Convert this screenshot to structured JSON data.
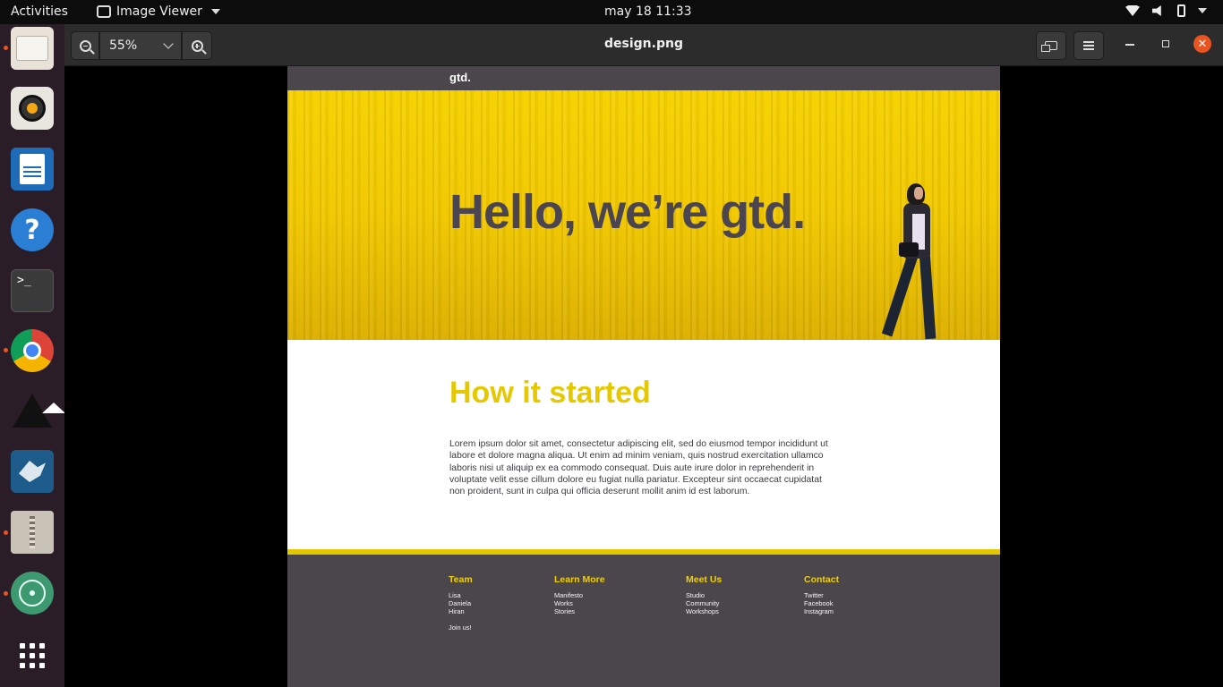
{
  "topbar": {
    "activities": "Activities",
    "app_name": "Image Viewer",
    "clock": "may 18  11:33"
  },
  "dock": {
    "apps": [
      "Files",
      "Rhythmbox",
      "LibreOffice Writer",
      "Help",
      "Terminal",
      "Google Chrome",
      "Inkscape",
      "MySQL Workbench",
      "Archive Manager",
      "Atom",
      "Show Applications"
    ],
    "running_indicators": [
      "Files",
      "Google Chrome",
      "Archive Manager",
      "Atom"
    ]
  },
  "viewer": {
    "zoom": "55%",
    "filename": "design.png",
    "close_glyph": "✕"
  },
  "design": {
    "logo": "gtd.",
    "hero_headline": "Hello, we’re gtd.",
    "section_heading": "How it started",
    "paragraph": "Lorem ipsum dolor sit amet, consectetur adipiscing elit, sed do eiusmod tempor incididunt ut labore et dolore magna aliqua. Ut enim ad minim veniam, quis nostrud exercitation ullamco laboris nisi ut aliquip ex ea commodo consequat. Duis aute irure dolor in reprehenderit in voluptate velit esse cillum dolore eu fugiat nulla pariatur. Excepteur sint occaecat cupidatat non proident, sunt in culpa qui officia deserunt mollit anim id est laborum.",
    "footer": {
      "team": {
        "heading": "Team",
        "items": [
          "Lisa",
          "Daniela",
          "Hiran"
        ],
        "extra": "Join us!"
      },
      "learn_more": {
        "heading": "Learn More",
        "items": [
          "Manifesto",
          "Works",
          "Stories"
        ]
      },
      "meet_us": {
        "heading": "Meet Us",
        "items": [
          "Studio",
          "Community",
          "Workshops"
        ]
      },
      "contact": {
        "heading": "Contact",
        "items": [
          "Twitter",
          "Facebook",
          "Instagram"
        ]
      }
    }
  },
  "colors": {
    "accent_yellow": "#f1c800",
    "footer_gray": "#4b464c",
    "close_orange": "#e95420"
  }
}
